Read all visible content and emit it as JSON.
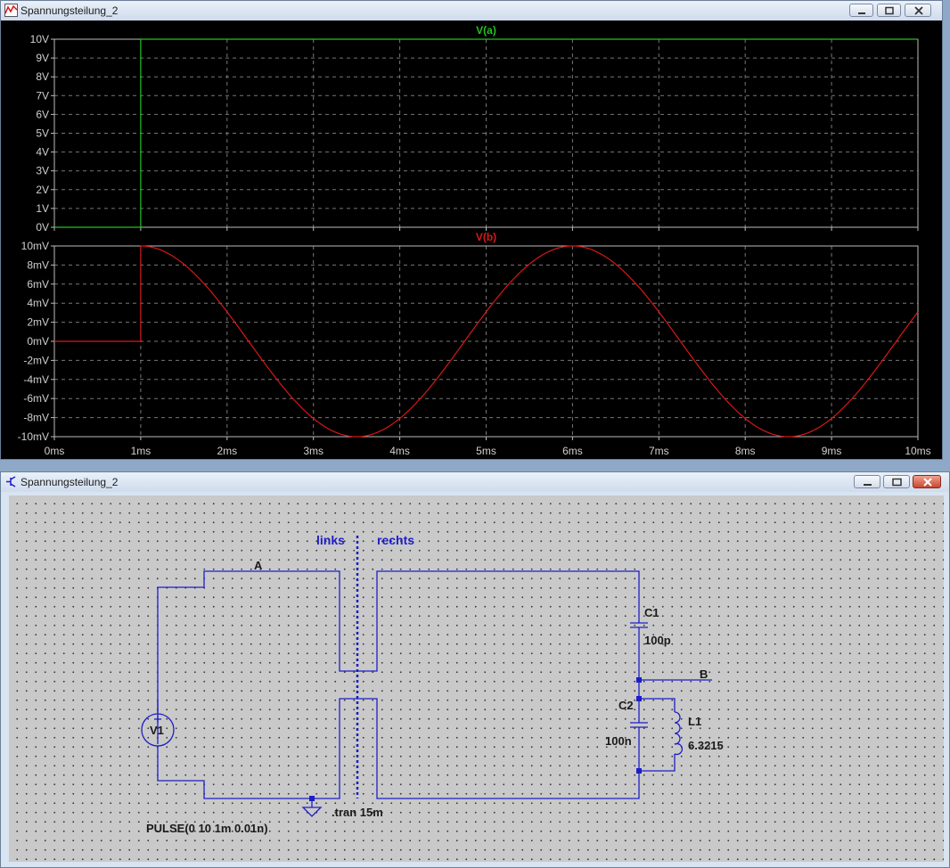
{
  "plot_window": {
    "title": "Spannungsteilung_2",
    "icon": "waveform-icon",
    "controls": [
      "minimize-icon",
      "maximize-icon",
      "close-icon"
    ]
  },
  "schematic_window": {
    "title": "Spannungsteilung_2",
    "icon": "schematic-icon",
    "controls": [
      "minimize-icon",
      "maximize-icon",
      "close-icon"
    ],
    "labels": {
      "links": "links",
      "rechts": "rechts",
      "node_a": "A",
      "node_b": "B",
      "c1_name": "C1",
      "c1_value": "100p",
      "c2_name": "C2",
      "c2_value": "100n",
      "l1_name": "L1",
      "l1_value": "6.3215",
      "v1_name": "V1",
      "directive": ".tran 15m",
      "source_value": "PULSE(0 10 1m 0.01n)"
    },
    "colors": {
      "wire": "#1e1ec8",
      "component": "#1e1ec8",
      "junction": "#1e1ec8",
      "background": "#c9c9c9"
    }
  },
  "chart_data": [
    {
      "type": "line",
      "title": "V(a)",
      "x_ticks": [
        "0ms",
        "1ms",
        "2ms",
        "3ms",
        "4ms",
        "5ms",
        "6ms",
        "7ms",
        "8ms",
        "9ms",
        "10ms"
      ],
      "y_ticks": [
        "10V",
        "9V",
        "8V",
        "7V",
        "6V",
        "5V",
        "4V",
        "3V",
        "2V",
        "1V",
        "0V"
      ],
      "xlim": [
        0,
        10
      ],
      "ylim": [
        0,
        10
      ],
      "grid": true,
      "color": "#22c022",
      "series": [
        {
          "x": [
            0,
            1,
            1,
            10
          ],
          "y": [
            0,
            0,
            10,
            10
          ]
        }
      ]
    },
    {
      "type": "line",
      "title": "V(b)",
      "x_ticks": [
        "0ms",
        "1ms",
        "2ms",
        "3ms",
        "4ms",
        "5ms",
        "6ms",
        "7ms",
        "8ms",
        "9ms",
        "10ms"
      ],
      "y_ticks": [
        "10mV",
        "8mV",
        "6mV",
        "4mV",
        "2mV",
        "0mV",
        "-2mV",
        "-4mV",
        "-6mV",
        "-8mV",
        "-10mV"
      ],
      "xlim": [
        0,
        10
      ],
      "ylim": [
        -10,
        10
      ],
      "grid": true,
      "color": "#d81818",
      "series": [
        {
          "x": [
            0,
            1,
            1,
            1.5,
            2,
            2.5,
            3,
            3.5,
            4,
            4.5,
            5,
            5.5,
            6,
            6.5,
            7,
            7.5,
            8,
            8.5,
            9,
            9.5,
            10
          ],
          "y": [
            0,
            0,
            10,
            8.1,
            3.1,
            -3.1,
            -8.1,
            -10,
            -8.1,
            -3.1,
            3.1,
            8.1,
            10,
            8.1,
            3.1,
            -3.1,
            -8.1,
            -10,
            -8.1,
            -3.1,
            3.1
          ]
        }
      ]
    }
  ]
}
